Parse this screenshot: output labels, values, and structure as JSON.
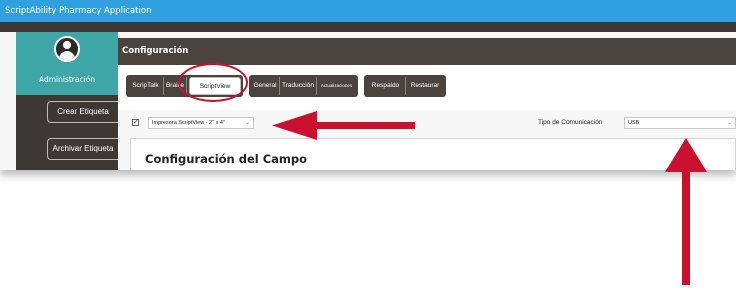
{
  "app": {
    "title": "ScriptAbility Pharmacy Application"
  },
  "sidebar": {
    "admin_label": "Administración",
    "buttons": [
      {
        "label": "Crear Etiqueta"
      },
      {
        "label": "Archivar Etiqueta"
      }
    ]
  },
  "main": {
    "header": "Configuración",
    "tab_groups": [
      {
        "tabs": [
          {
            "label": "ScripTalk"
          },
          {
            "label": "Braille"
          },
          {
            "label": "ScriptView",
            "selected": true
          }
        ]
      },
      {
        "tabs": [
          {
            "label": "General"
          },
          {
            "label": "Traducción"
          },
          {
            "label": "Actualizaciones"
          }
        ]
      },
      {
        "tabs": [
          {
            "label": "Respaldo"
          },
          {
            "label": "Restaurar"
          }
        ]
      }
    ],
    "printer_enabled": true,
    "printer_select": {
      "value": "Impresora ScriptView - 2\" x 4\""
    },
    "communication": {
      "label": "Tipo de Comunicación",
      "value": "USB"
    },
    "field_config_title": "Configuración del Campo"
  },
  "annotations": {
    "color": "#c9102e"
  }
}
